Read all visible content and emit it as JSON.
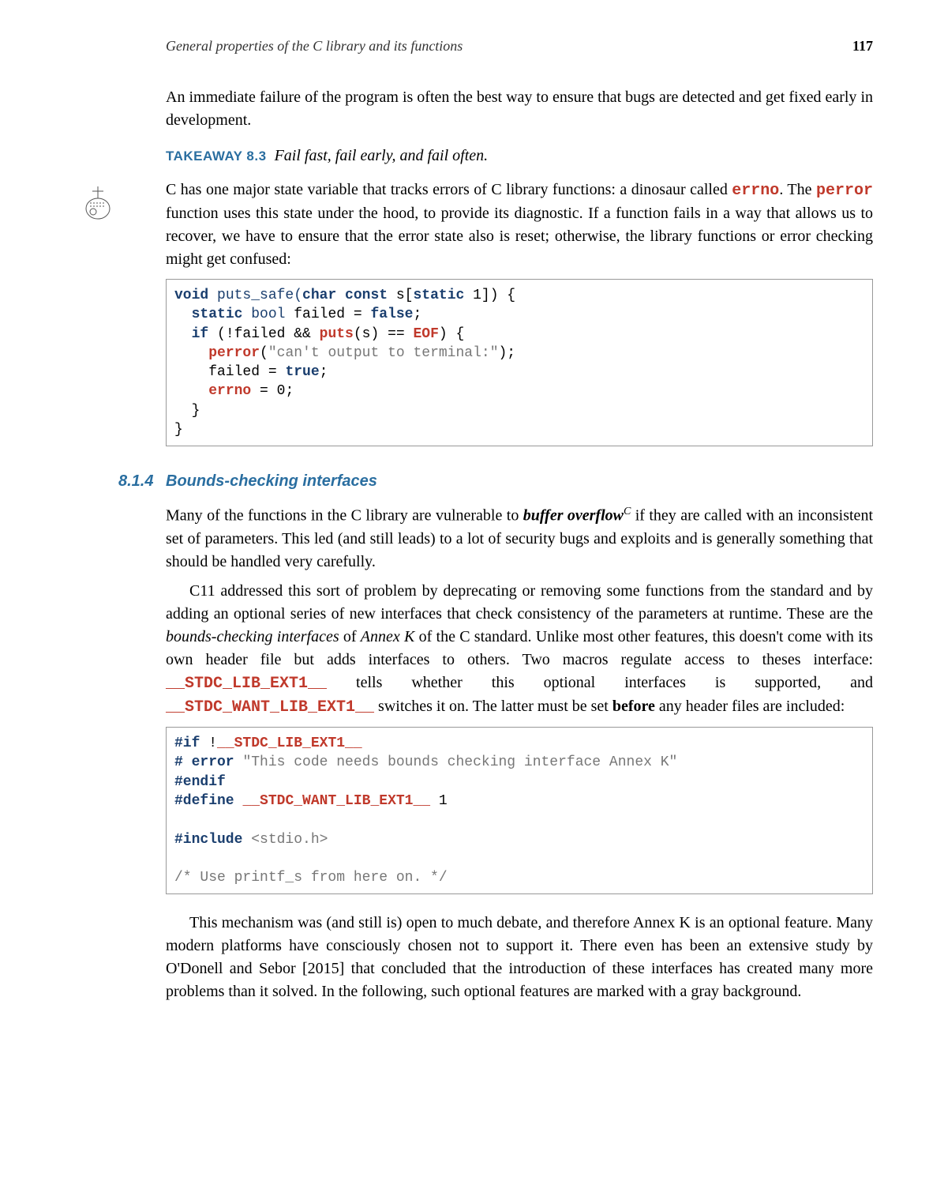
{
  "header": {
    "title": "General properties of the C library and its functions",
    "pageno": "117"
  },
  "para1": "An immediate failure of the program is often the best way to ensure that bugs are detected and get fixed early in development.",
  "takeaway": {
    "label": "TAKEAWAY 8.3",
    "body": "Fail fast, fail early, and fail often."
  },
  "para2a": "C has one major state variable that tracks errors of C library functions: a dinosaur called ",
  "para2b": ". The ",
  "para2c": " function uses this state under the hood, to provide its diagnostic. If a function fails in a way that allows us to recover, we have to ensure that the error state also is reset; otherwise, the library functions or error checking might get confused:",
  "errno": "errno",
  "perror": "perror",
  "code1": {
    "l1a": "void",
    "l1b": " puts_safe(",
    "l1c": "char const",
    "l1d": " s[",
    "l1e": "static",
    "l1f": " 1]) {",
    "l2a": "  ",
    "l2b": "static",
    "l2c": " bool",
    "l2d": " failed = ",
    "l2e": "false",
    "l2f": ";",
    "l3a": "  ",
    "l3b": "if",
    "l3c": " (!failed && ",
    "l3d": "puts",
    "l3e": "(s) == ",
    "l3f": "EOF",
    "l3g": ") {",
    "l4a": "    ",
    "l4b": "perror",
    "l4c": "(",
    "l4d": "\"can't output to terminal:\"",
    "l4e": ");",
    "l5a": "    failed = ",
    "l5b": "true",
    "l5c": ";",
    "l6a": "    ",
    "l6b": "errno",
    "l6c": " = 0;",
    "l7": "  }",
    "l8": "}"
  },
  "section": {
    "num": "8.1.4",
    "title": "Bounds-checking interfaces"
  },
  "para3a": "Many of the functions in the C library are vulnerable to ",
  "para3b": "buffer overflow",
  "para3sup": "C",
  "para3c": " if they are called with an inconsistent set of parameters. This led (and still leads) to a lot of security bugs and exploits and is generally something that should be handled very carefully.",
  "para4a": "C11 addressed this sort of problem by deprecating or removing some functions from the standard and by adding an optional series of new interfaces that check consistency of the parameters at runtime. These are the ",
  "para4b": "bounds-checking interfaces",
  "para4c": " of ",
  "para4d": "Annex K",
  "para4e": " of the C standard. Unlike most other features, this doesn't come with its own header file but adds interfaces to others. Two macros regulate access to theses interface: ",
  "macro1": "__STDC_LIB_EXT1__",
  "para4f": " tells whether this optional interfaces is supported, and ",
  "macro2": "__STDC_WANT_LIB_EXT1__",
  "para4g": " switches it on. The latter must be set ",
  "before": "before",
  "para4h": " any header files are included:",
  "code2": {
    "l1a": "#if",
    "l1b": " !",
    "l1c": "__STDC_LIB_EXT1__",
    "l2a": "# error",
    "l2b": " ",
    "l2c": "\"This code needs bounds checking interface Annex K\"",
    "l3": "#endif",
    "l4a": "#define",
    "l4b": " ",
    "l4c": "__STDC_WANT_LIB_EXT1__",
    "l4d": " 1",
    "blank": "",
    "l5a": "#include",
    "l5b": " <stdio.h>",
    "l6": "/* Use printf_s from here on. */"
  },
  "para5": "This mechanism was (and still is) open to much debate, and therefore Annex K is an optional feature. Many modern platforms have consciously chosen not to support it. There even has been an extensive study by O'Donell and Sebor [2015] that concluded that the introduction of these interfaces has created many more problems than it solved. In the following, such optional features are marked with a gray background."
}
